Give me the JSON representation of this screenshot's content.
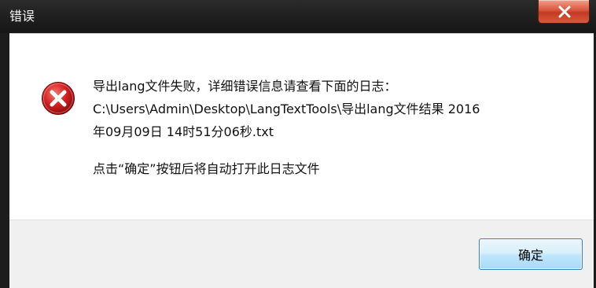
{
  "window": {
    "title": "错误",
    "close_icon": "close-icon"
  },
  "message": {
    "icon": "error-icon",
    "lines": [
      "导出lang文件失败，详细错误信息请查看下面的日志：",
      "C:\\Users\\Admin\\Desktop\\LangTextTools\\导出lang文件结果 2016",
      "年09月09日 14时51分06秒.txt"
    ],
    "instruction": "点击“确定”按钮后将自动打开此日志文件"
  },
  "buttons": {
    "ok_label": "确定"
  },
  "colors": {
    "titlebar": "#1c1c1c",
    "close_button": "#c94a31",
    "error_icon": "#d32222",
    "footer": "#f0f0f0",
    "button_border": "#3c7fb1"
  }
}
